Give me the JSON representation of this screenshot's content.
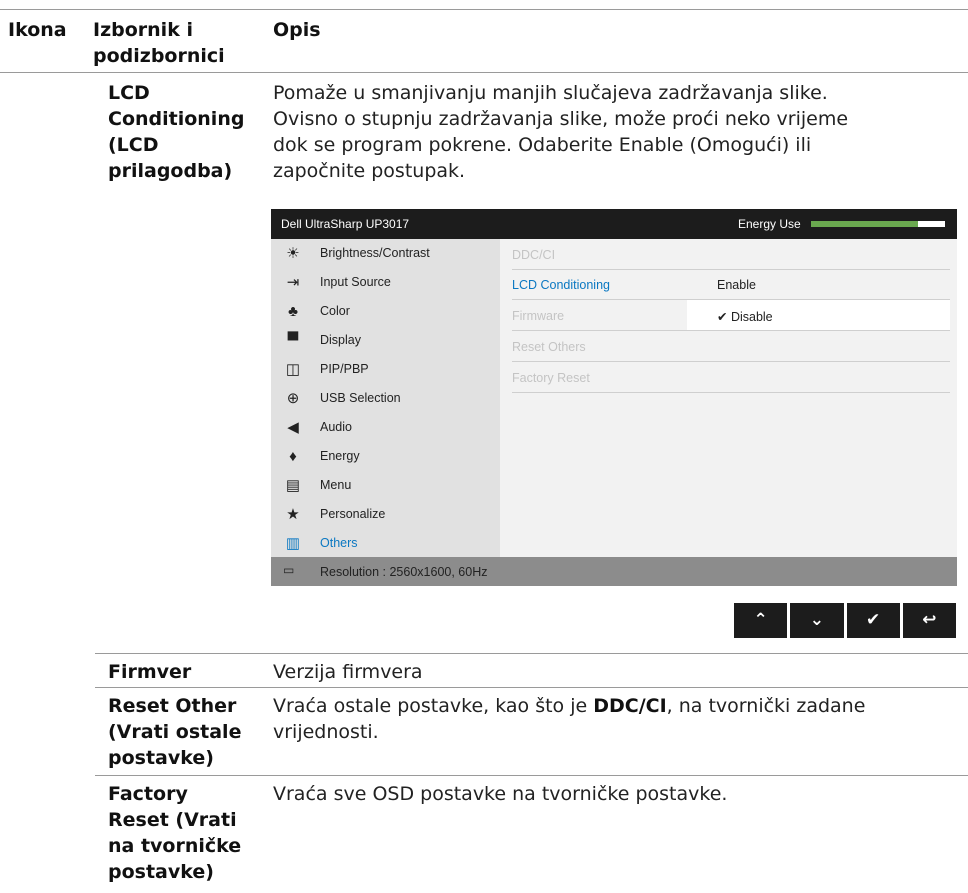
{
  "header": {
    "col1": "Ikona",
    "col2_line1": "Izbornik i",
    "col2_line2": "podizbornici",
    "col3": "Opis"
  },
  "lcd": {
    "term": [
      "LCD",
      "Conditioning",
      "(LCD",
      "prilagodba)"
    ],
    "desc": [
      "Pomaže u smanjivanju manjih slučajeva zadržavanja slike.",
      "Ovisno o stupnju zadržavanja slike, može proći neko vrijeme",
      "dok se program pokrene. Odaberite Enable (Omogući) ili",
      "započnite postupak."
    ]
  },
  "osd": {
    "title": "Dell UltraSharp UP3017",
    "energy_label": "Energy Use",
    "energy_level_fraction": 0.8,
    "colors": {
      "accent": "#0b78c2",
      "energy": "#6aa84f"
    },
    "menu": [
      {
        "label": "Brightness/Contrast",
        "icon": "brightness-icon",
        "glyph": "☀"
      },
      {
        "label": "Input Source",
        "icon": "input-source-icon",
        "glyph": "⇥"
      },
      {
        "label": "Color",
        "icon": "color-icon",
        "glyph": "♣"
      },
      {
        "label": "Display",
        "icon": "display-icon",
        "glyph": "▀"
      },
      {
        "label": "PIP/PBP",
        "icon": "pip-icon",
        "glyph": "◫"
      },
      {
        "label": "USB Selection",
        "icon": "usb-icon",
        "glyph": "⊕"
      },
      {
        "label": "Audio",
        "icon": "audio-icon",
        "glyph": "◀"
      },
      {
        "label": "Energy",
        "icon": "energy-icon",
        "glyph": "♦"
      },
      {
        "label": "Menu",
        "icon": "menu-icon",
        "glyph": "▤"
      },
      {
        "label": "Personalize",
        "icon": "star-icon",
        "glyph": "★"
      },
      {
        "label": "Others",
        "icon": "others-icon",
        "glyph": "▥"
      }
    ],
    "rows": [
      {
        "label": "DDC/CI",
        "value": ""
      },
      {
        "label": "LCD Conditioning",
        "value": "Enable"
      },
      {
        "label": "Firmware",
        "value": "✔ Disable"
      },
      {
        "label": "Reset Others",
        "value": ""
      },
      {
        "label": "Factory Reset",
        "value": ""
      }
    ],
    "footer": "Resolution : 2560x1600, 60Hz"
  },
  "nav": {
    "up": "⌃",
    "down": "⌄",
    "check": "✔",
    "back": "↩"
  },
  "firmver": {
    "term": "Firmver",
    "desc": "Verzija firmvera"
  },
  "reset_other": {
    "term": [
      "Reset Other",
      "(Vrati ostale",
      "postavke)"
    ],
    "desc_line1_a": "Vraća ostale postavke, kao što je ",
    "desc_line1_b": "DDC/CI",
    "desc_line1_c": ", na tvornički zadane",
    "desc_line2": "vrijednosti."
  },
  "factory_reset": {
    "term": [
      "Factory",
      "Reset (Vrati",
      "na tvorničke",
      "postavke)"
    ],
    "desc": "Vraća sve OSD postavke na tvorničke postavke."
  }
}
